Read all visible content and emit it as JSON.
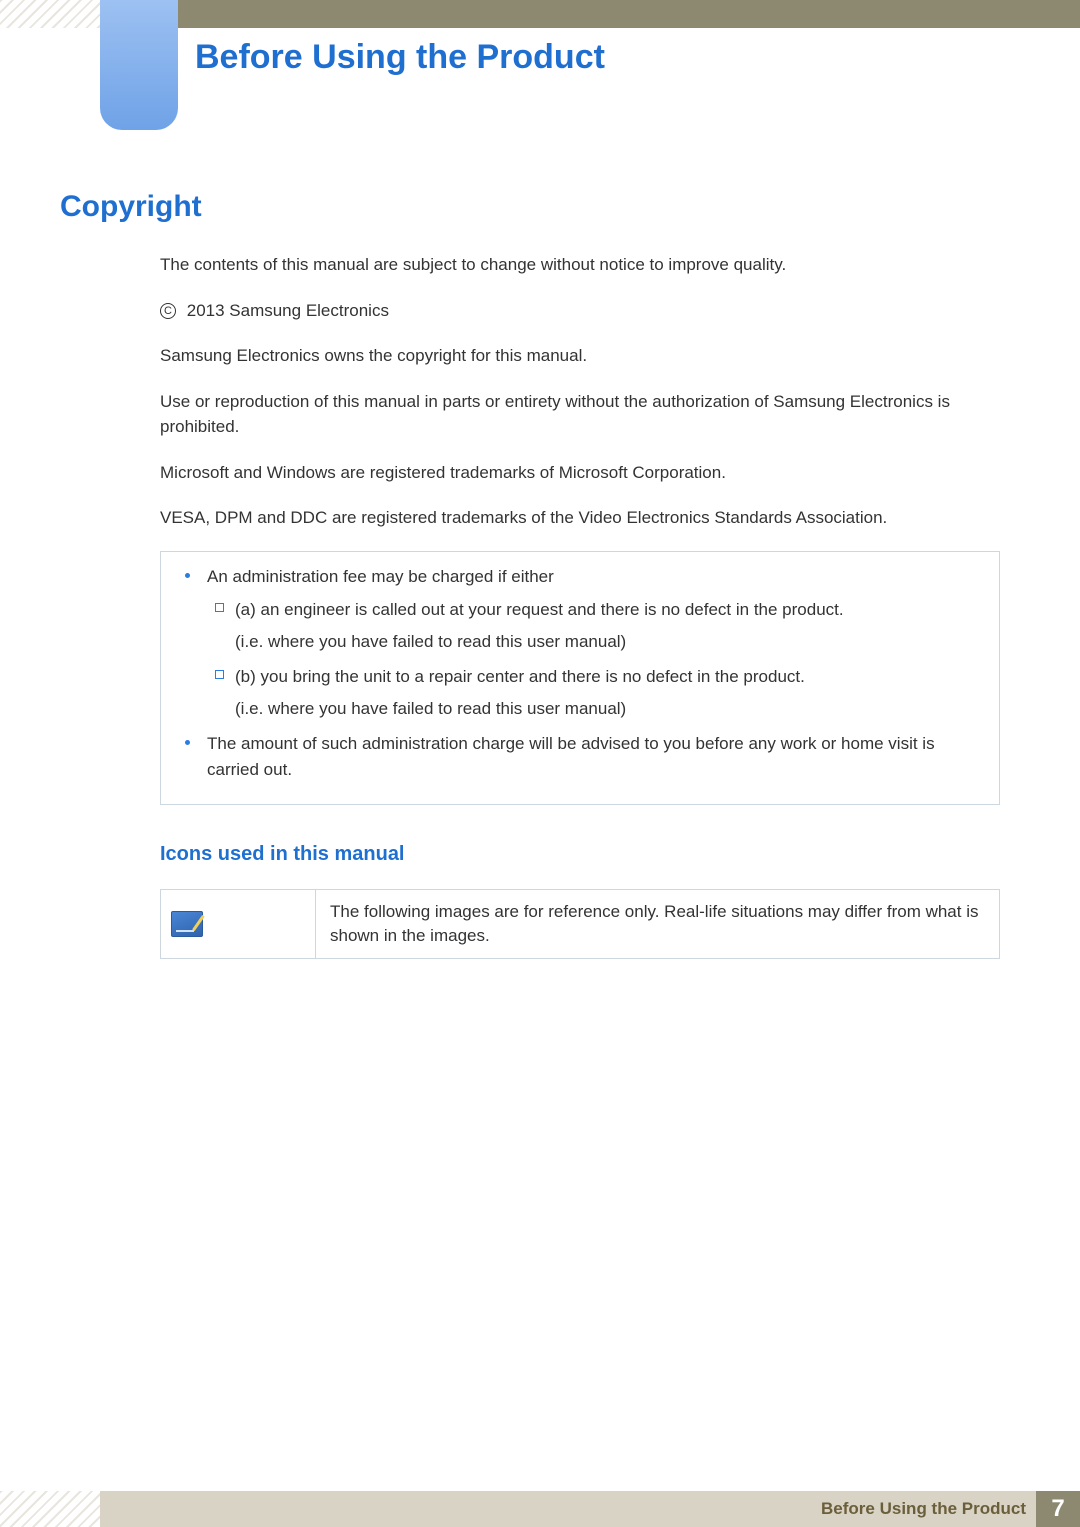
{
  "chapterTitle": "Before Using the Product",
  "section": {
    "heading": "Copyright",
    "paragraphs": [
      "The contents of this manual are subject to change without notice to improve quality.",
      "2013 Samsung Electronics",
      "Samsung Electronics owns the copyright for this manual.",
      "Use or reproduction of this manual in parts or entirety without the authorization of Samsung Electronics is prohibited.",
      "Microsoft and Windows are registered trademarks of Microsoft Corporation.",
      "VESA, DPM and DDC are registered trademarks of the Video Electronics Standards Association."
    ],
    "notice": {
      "items": [
        {
          "text": "An administration fee may be charged if either",
          "sub": [
            {
              "line": "(a) an engineer is called out at your request and there is no defect in the product.",
              "cont": "(i.e. where you have failed to read this user manual)"
            },
            {
              "line": "(b) you bring the unit to a repair center and there is no defect in the product.",
              "cont": "(i.e. where you have failed to read this user manual)"
            }
          ]
        },
        {
          "text": "The amount of such administration charge will be advised to you before any work or home visit is carried out.",
          "sub": []
        }
      ]
    },
    "subheading": "Icons used in this manual",
    "iconTable": {
      "iconName": "reference-image-icon",
      "description": "The following images are for reference only. Real-life situations may differ from what is shown in the images."
    }
  },
  "footer": {
    "label": "Before Using the Product",
    "pageNumber": "7"
  },
  "copyrightSymbol": "C"
}
